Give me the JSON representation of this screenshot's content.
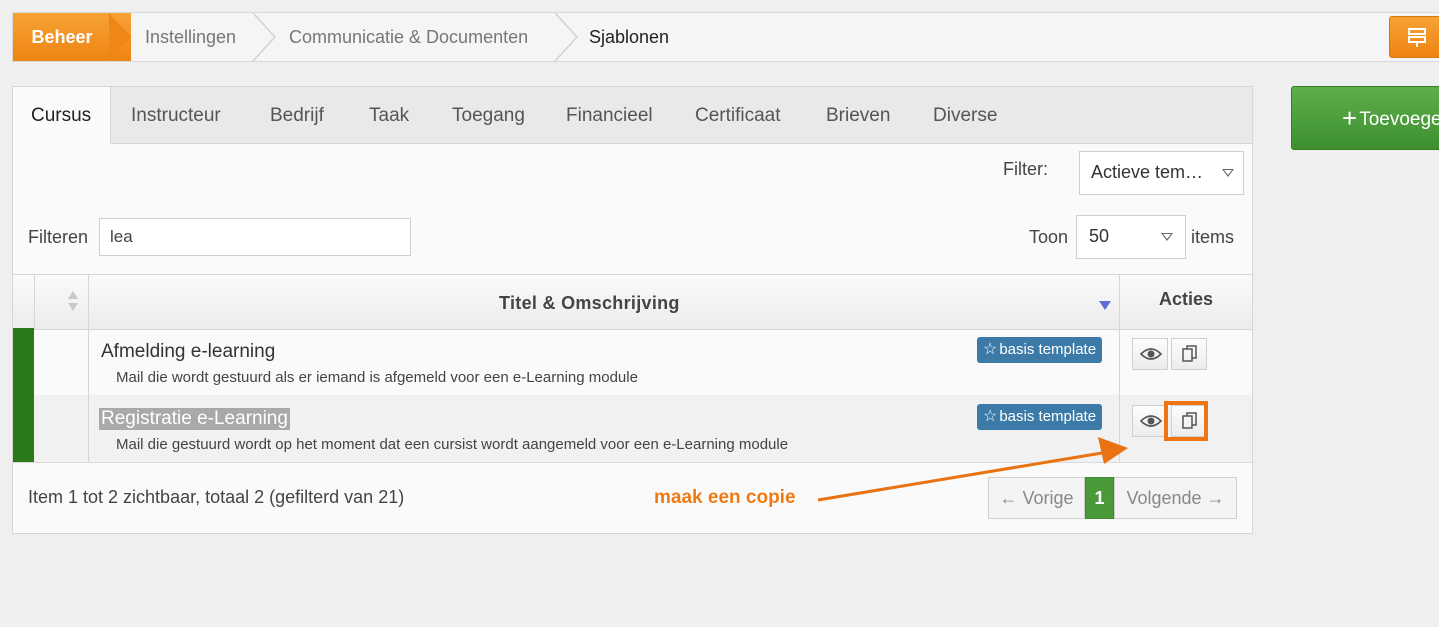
{
  "breadcrumb": {
    "home": "Beheer",
    "items": [
      "Instellingen",
      "Communicatie & Documenten"
    ],
    "current": "Sjablonen"
  },
  "add_button": {
    "icon": "plus-icon",
    "label": "Toevoegen"
  },
  "tabs": [
    {
      "label": "Cursus",
      "active": true
    },
    {
      "label": "Instructeur"
    },
    {
      "label": "Bedrijf"
    },
    {
      "label": "Taak"
    },
    {
      "label": "Toegang"
    },
    {
      "label": "Financieel"
    },
    {
      "label": "Certificaat"
    },
    {
      "label": "Brieven"
    },
    {
      "label": "Diverse"
    }
  ],
  "filter": {
    "label": "Filter:",
    "selected": "Actieve tem…"
  },
  "search": {
    "label": "Filteren",
    "value": "lea"
  },
  "page_size": {
    "label_before": "Toon",
    "value": "50",
    "label_after": "items"
  },
  "table": {
    "headers": {
      "title": "Titel & Omschrijving",
      "actions": "Acties"
    },
    "rows": [
      {
        "title": "Afmelding e-learning",
        "description": "Mail die wordt gestuurd als er iemand is afgemeld voor een e-Learning module",
        "badge": "basis template"
      },
      {
        "title": "Registratie e-Learning",
        "description": "Mail die gestuurd wordt op het moment dat een cursist wordt aangemeld voor een e-Learning module",
        "badge": "basis template"
      }
    ]
  },
  "footer": {
    "summary": "Item 1 tot 2 zichtbaar, totaal 2 (gefilterd van 21)"
  },
  "pagination": {
    "prev": "← Vorige",
    "current": "1",
    "next": "Volgende →"
  },
  "annotation": {
    "text": "maak een copie"
  },
  "colors": {
    "brand_orange": "#ee8413",
    "success_green": "#3d8f2e",
    "row_indicator": "#2a7a1b",
    "badge_blue": "#3c7ba7"
  }
}
